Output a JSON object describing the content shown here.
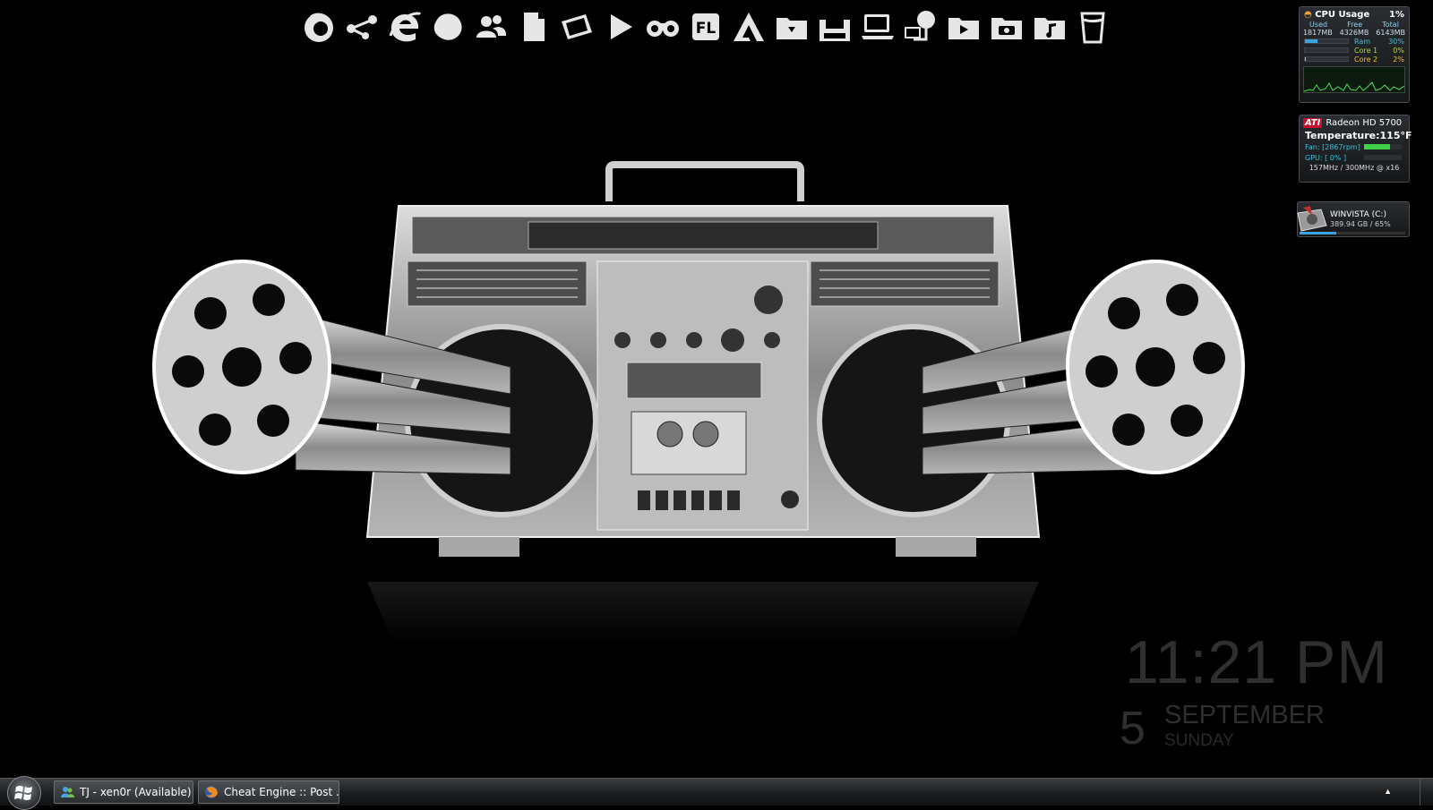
{
  "dock": {
    "icons": [
      "firefox-icon",
      "share-icon",
      "internet-explorer-icon",
      "messenger-icon",
      "contacts-icon",
      "document-icon",
      "picture-icon",
      "play-icon",
      "binoculars-icon",
      "fl-studio-icon",
      "adobe-icon",
      "folder-icon",
      "save-icon",
      "computer-icon",
      "network-icon",
      "videos-folder-icon",
      "pictures-folder-icon",
      "music-folder-icon",
      "recycle-bin-icon"
    ],
    "fl_label": "FL"
  },
  "cpu_gadget": {
    "title": "CPU Usage",
    "cpu_percent": "1%",
    "col_used": "Used",
    "col_free": "Free",
    "col_total": "Total",
    "used": "1817MB",
    "free": "4326MB",
    "total": "6143MB",
    "ram_label": "Ram",
    "ram_value": "30%",
    "ram_fill": 0.3,
    "core1_label": "Core 1",
    "core1_value": "0%",
    "core1_fill": 0.0,
    "core2_label": "Core 2",
    "core2_value": "2%",
    "core2_fill": 0.02
  },
  "gpu_gadget": {
    "brand": "ATI",
    "model": "Radeon HD 5700",
    "temp_label": "Temperature:",
    "temp_value": "115°F",
    "fan_label": "Fan: [2867rpm]",
    "fan_fill": 0.7,
    "gpu_label": "GPU: [ 0% ]",
    "gpu_fill": 0.0,
    "clock": "157MHz / 300MHz @ x16"
  },
  "drive_gadget": {
    "name": "WINVISTA (C:)",
    "detail": "389.94 GB / 65%",
    "fill": 0.35
  },
  "clock": {
    "time": "11:21 PM",
    "day": "5",
    "month": "SEPTEMBER",
    "weekday": "SUNDAY"
  },
  "taskbar": {
    "tasks": [
      {
        "label": "TJ - xen0r (Available)",
        "icon": "messenger-icon"
      },
      {
        "label": "Cheat Engine :: Post ...",
        "icon": "firefox-icon"
      }
    ],
    "tray_arrow": "▲"
  },
  "colors": {
    "background": "#000000",
    "dock_icon": "#e6e6e6",
    "clock_text": "#2f2f2f",
    "gadget_accent": "#3aa4e0",
    "gpu_bar": "#3fd14a",
    "ati_red": "#c8102e"
  }
}
